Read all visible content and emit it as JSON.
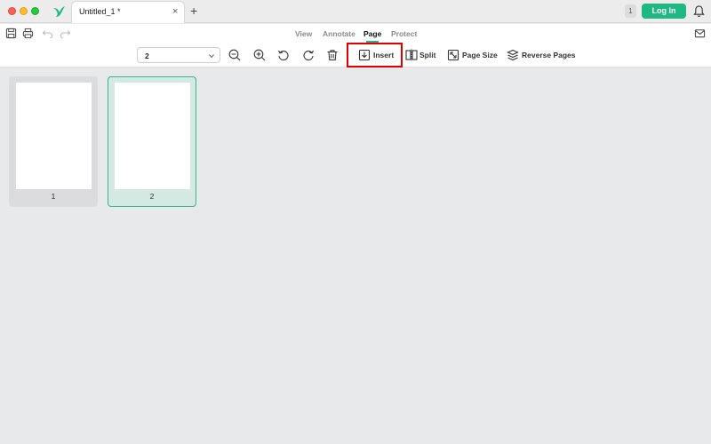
{
  "titlebar": {
    "tab_title": "Untitled_1 *",
    "tab_close": "×",
    "tab_add": "+",
    "notification_count": "1",
    "login_label": "Log In"
  },
  "menu": {
    "items": [
      "View",
      "Annotate",
      "Page",
      "Protect"
    ],
    "active": "Page"
  },
  "toolbar": {
    "page_select_value": "2",
    "insert_label": "Insert",
    "split_label": "Split",
    "page_size_label": "Page Size",
    "reverse_pages_label": "Reverse Pages"
  },
  "pages": [
    {
      "number": "1",
      "selected": false
    },
    {
      "number": "2",
      "selected": true
    }
  ],
  "colors": {
    "accent": "#1fb883",
    "highlight": "#e00000",
    "background": "#e8e9eb"
  },
  "icons": [
    "bird-logo-icon",
    "bell-icon",
    "save-icon",
    "print-icon",
    "undo-icon",
    "redo-icon",
    "mail-icon",
    "zoom-out-icon",
    "zoom-in-icon",
    "rotate-left-icon",
    "rotate-right-icon",
    "trash-icon",
    "insert-icon",
    "split-icon",
    "page-size-icon",
    "reverse-pages-icon"
  ]
}
